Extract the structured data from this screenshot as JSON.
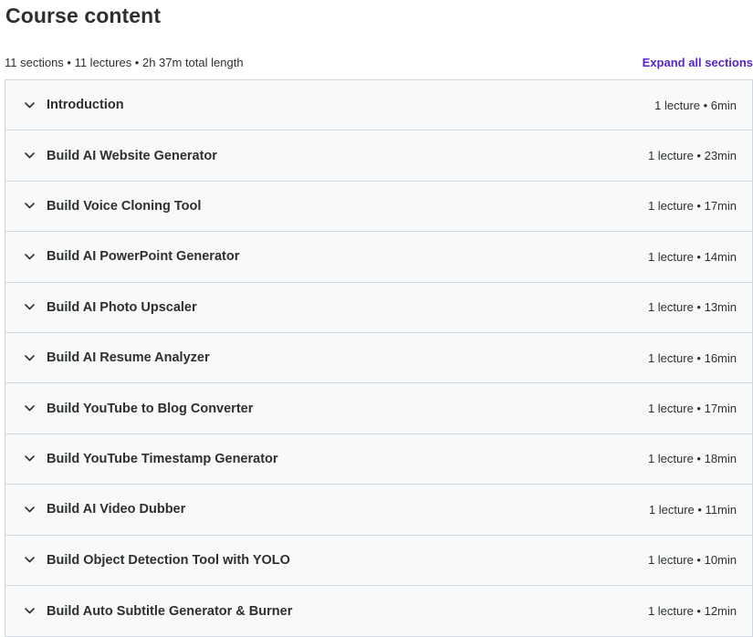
{
  "header": {
    "title": "Course content",
    "summary": "11 sections • 11 lectures • 2h 37m total length",
    "expand_all_label": "Expand all sections"
  },
  "sections": [
    {
      "title": "Introduction",
      "meta": "1 lecture • 6min",
      "icon": "chevron-down-icon"
    },
    {
      "title": "Build AI Website Generator",
      "meta": "1 lecture • 23min",
      "icon": "chevron-down-icon"
    },
    {
      "title": "Build Voice Cloning Tool",
      "meta": "1 lecture • 17min",
      "icon": "chevron-down-icon"
    },
    {
      "title": "Build AI PowerPoint Generator",
      "meta": "1 lecture • 14min",
      "icon": "chevron-down-icon"
    },
    {
      "title": "Build AI Photo Upscaler",
      "meta": "1 lecture • 13min",
      "icon": "chevron-down-icon"
    },
    {
      "title": "Build AI Resume Analyzer",
      "meta": "1 lecture • 16min",
      "icon": "chevron-down-icon"
    },
    {
      "title": "Build YouTube to Blog Converter",
      "meta": "1 lecture • 17min",
      "icon": "chevron-down-icon"
    },
    {
      "title": "Build YouTube Timestamp Generator",
      "meta": "1 lecture • 18min",
      "icon": "chevron-down-icon"
    },
    {
      "title": "Build AI Video Dubber",
      "meta": "1 lecture • 11min",
      "icon": "chevron-down-icon"
    },
    {
      "title": "Build Object Detection Tool with YOLO",
      "meta": "1 lecture • 10min",
      "icon": "chevron-down-icon"
    },
    {
      "title": "Build Auto Subtitle Generator & Burner",
      "meta": "1 lecture • 12min",
      "icon": "chevron-down-icon"
    }
  ],
  "colors": {
    "text": "#2d2f31",
    "accent": "#5624d0",
    "section_bg": "#f7f9fa",
    "border": "#d1d7dc"
  }
}
